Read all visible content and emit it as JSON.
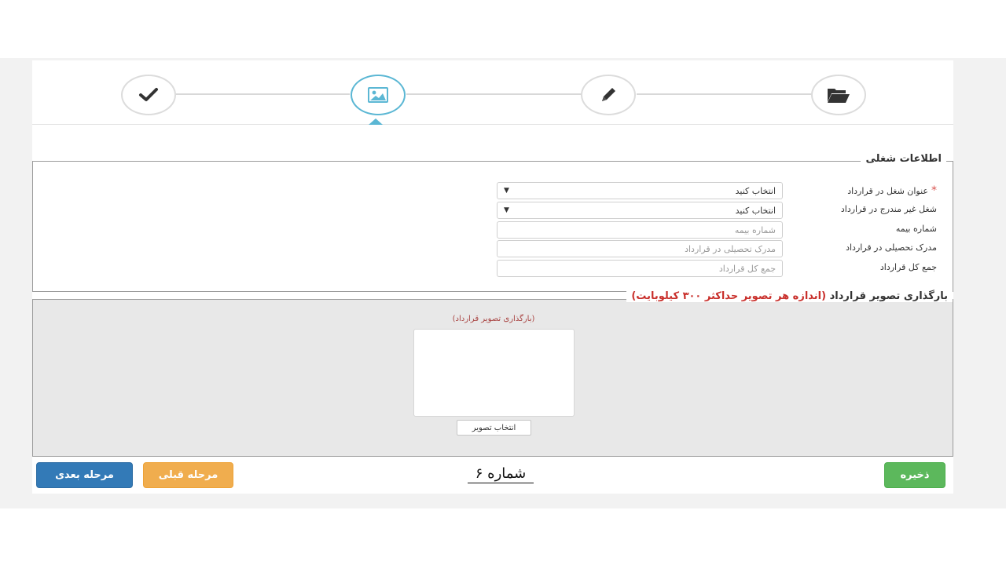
{
  "wizard": {
    "steps": [
      {
        "icon": "check-icon",
        "state": "pending"
      },
      {
        "icon": "image-icon",
        "state": "active"
      },
      {
        "icon": "pencil-icon",
        "state": "pending"
      },
      {
        "icon": "folder-open-icon",
        "state": "pending"
      }
    ],
    "active_color": "#5bb7d4"
  },
  "job_info": {
    "legend": "اطلاعات شغلی",
    "fields": [
      {
        "label": "عنوان شغل در قرارداد",
        "required": true,
        "type": "select",
        "value": "انتخاب کنید"
      },
      {
        "label": "شغل غیر مندرج در قرارداد",
        "required": false,
        "type": "select",
        "value": "انتخاب کنید"
      },
      {
        "label": "شماره بیمه",
        "required": false,
        "type": "text",
        "placeholder": "شماره بیمه"
      },
      {
        "label": "مدرک تحصیلی در قرارداد",
        "required": false,
        "type": "text",
        "placeholder": "مدرک تحصیلی در قرارداد"
      },
      {
        "label": "جمع کل قرارداد",
        "required": false,
        "type": "text",
        "placeholder": "جمع کل قرارداد"
      }
    ]
  },
  "upload": {
    "legend": "بارگذاری تصویر قرارداد",
    "note": "(اندازه هر تصویر حداکثر ۳۰۰ کیلوبایت)",
    "hint": "(بارگذاری تصویر قرارداد)",
    "choose_label": "انتخاب تصویر"
  },
  "buttons": {
    "next": "مرحله بعدی",
    "prev": "مرحله قبلی",
    "save": "ذخیره"
  },
  "caption": "شماره ۶",
  "colors": {
    "primary": "#337ab7",
    "warning": "#f0ad4e",
    "success": "#5cb85c",
    "danger": "#c9302c"
  }
}
